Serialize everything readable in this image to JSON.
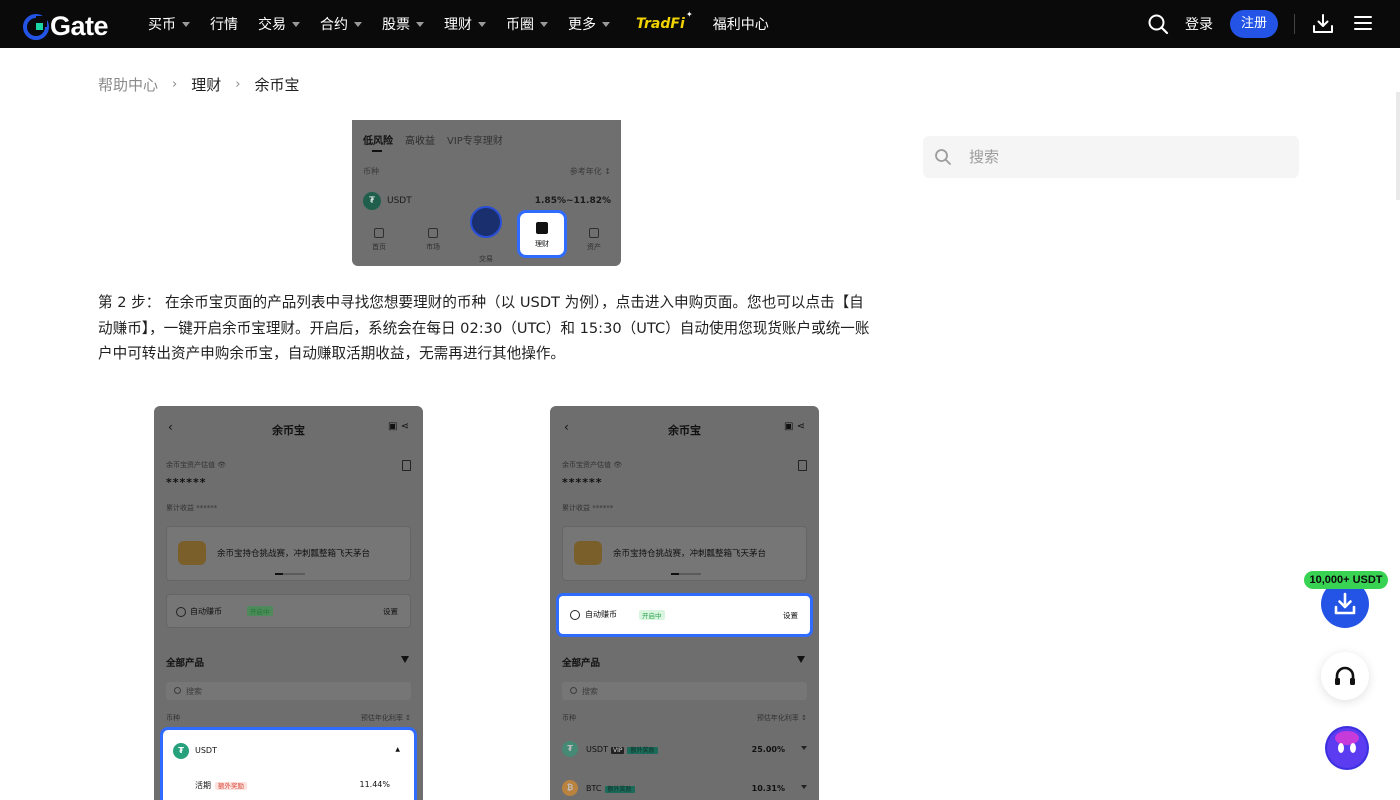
{
  "nav": {
    "logo": "Gate",
    "items": [
      {
        "label": "买币",
        "caret": true
      },
      {
        "label": "行情",
        "caret": false
      },
      {
        "label": "交易",
        "caret": true
      },
      {
        "label": "合约",
        "caret": true
      },
      {
        "label": "股票",
        "caret": true
      },
      {
        "label": "理财",
        "caret": true
      },
      {
        "label": "币圈",
        "caret": true
      },
      {
        "label": "更多",
        "caret": true
      }
    ],
    "tradfi": "TradFi",
    "welfare": "福利中心",
    "login": "登录",
    "register": "注册",
    "accent": "#2354e6"
  },
  "breadcrumb": {
    "home": "帮助中心",
    "section": "理财",
    "current": "余币宝"
  },
  "side_search": {
    "placeholder": "搜索"
  },
  "screenshot_top": {
    "tabs": [
      "低风险",
      "高收益",
      "VIP专享理财"
    ],
    "vip_tag": "VIP",
    "col_left": "币种",
    "col_right": "参考年化 ↕",
    "coin": "USDT",
    "apy_range": "1.85%~11.82%",
    "tabbar": [
      "首页",
      "市场",
      "交易",
      "理财",
      "资产"
    ]
  },
  "step2": {
    "text": "第 2 步： 在余币宝页面的产品列表中寻找您想要理财的币种（以 USDT 为例），点击进入申购页面。您也可以点击【自动赚币】，一键开启余币宝理财。开启后，系统会在每日 02:30（UTC）和 15:30（UTC）自动使用您现货账户或统一账户中可转出资产申购余币宝，自动赚取活期收益，无需再进行其他操作。"
  },
  "phone_left": {
    "title": "余币宝",
    "asset_label": "余币宝资产估值 👁",
    "asset_value": "******",
    "earn_label": "累计收益 ******",
    "banner": "余币宝持仓挑战赛，冲刺瓢整箱飞天茅台",
    "auto_label": "自动赚币",
    "auto_tag": "开启中",
    "auto_set": "设置",
    "all_products": "全部产品",
    "search_placeholder": "搜索",
    "col_left": "币种",
    "col_right": "预估年化利率 ↕",
    "usdt_name": "USDT",
    "flex_label": "活期",
    "flex_tag": "额外奖励",
    "flex_rate": "11.44%"
  },
  "phone_right": {
    "title": "余币宝",
    "asset_label": "余币宝资产估值 👁",
    "asset_value": "******",
    "earn_label": "累计收益 ******",
    "banner": "余币宝持仓挑战赛，冲刺瓢整箱飞天茅台",
    "auto_label": "自动赚币",
    "auto_tag": "开启中",
    "auto_set": "设置",
    "all_products": "全部产品",
    "search_placeholder": "搜索",
    "col_left": "币种",
    "col_right": "预估年化利率 ↕",
    "rows": [
      {
        "coin": "USDT",
        "vip": "VIP",
        "tag": "额外奖励",
        "rate": "25.00%"
      },
      {
        "coin": "BTC",
        "vip": "",
        "tag": "额外奖励",
        "rate": "10.31%"
      }
    ]
  },
  "floating": {
    "bonus_badge": "10,000+ USDT"
  }
}
